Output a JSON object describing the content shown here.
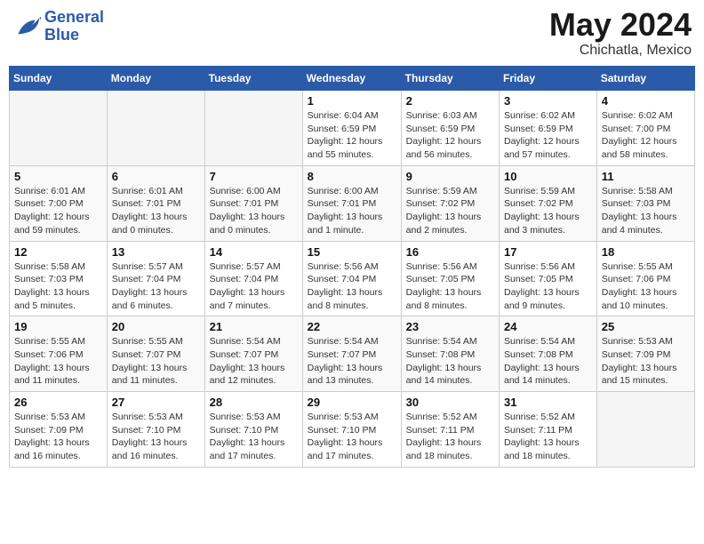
{
  "header": {
    "logo_line1": "General",
    "logo_line2": "Blue",
    "month": "May 2024",
    "location": "Chichatla, Mexico"
  },
  "days_of_week": [
    "Sunday",
    "Monday",
    "Tuesday",
    "Wednesday",
    "Thursday",
    "Friday",
    "Saturday"
  ],
  "weeks": [
    [
      {
        "day": "",
        "info": ""
      },
      {
        "day": "",
        "info": ""
      },
      {
        "day": "",
        "info": ""
      },
      {
        "day": "1",
        "info": "Sunrise: 6:04 AM\nSunset: 6:59 PM\nDaylight: 12 hours\nand 55 minutes."
      },
      {
        "day": "2",
        "info": "Sunrise: 6:03 AM\nSunset: 6:59 PM\nDaylight: 12 hours\nand 56 minutes."
      },
      {
        "day": "3",
        "info": "Sunrise: 6:02 AM\nSunset: 6:59 PM\nDaylight: 12 hours\nand 57 minutes."
      },
      {
        "day": "4",
        "info": "Sunrise: 6:02 AM\nSunset: 7:00 PM\nDaylight: 12 hours\nand 58 minutes."
      }
    ],
    [
      {
        "day": "5",
        "info": "Sunrise: 6:01 AM\nSunset: 7:00 PM\nDaylight: 12 hours\nand 59 minutes."
      },
      {
        "day": "6",
        "info": "Sunrise: 6:01 AM\nSunset: 7:01 PM\nDaylight: 13 hours\nand 0 minutes."
      },
      {
        "day": "7",
        "info": "Sunrise: 6:00 AM\nSunset: 7:01 PM\nDaylight: 13 hours\nand 0 minutes."
      },
      {
        "day": "8",
        "info": "Sunrise: 6:00 AM\nSunset: 7:01 PM\nDaylight: 13 hours\nand 1 minute."
      },
      {
        "day": "9",
        "info": "Sunrise: 5:59 AM\nSunset: 7:02 PM\nDaylight: 13 hours\nand 2 minutes."
      },
      {
        "day": "10",
        "info": "Sunrise: 5:59 AM\nSunset: 7:02 PM\nDaylight: 13 hours\nand 3 minutes."
      },
      {
        "day": "11",
        "info": "Sunrise: 5:58 AM\nSunset: 7:03 PM\nDaylight: 13 hours\nand 4 minutes."
      }
    ],
    [
      {
        "day": "12",
        "info": "Sunrise: 5:58 AM\nSunset: 7:03 PM\nDaylight: 13 hours\nand 5 minutes."
      },
      {
        "day": "13",
        "info": "Sunrise: 5:57 AM\nSunset: 7:04 PM\nDaylight: 13 hours\nand 6 minutes."
      },
      {
        "day": "14",
        "info": "Sunrise: 5:57 AM\nSunset: 7:04 PM\nDaylight: 13 hours\nand 7 minutes."
      },
      {
        "day": "15",
        "info": "Sunrise: 5:56 AM\nSunset: 7:04 PM\nDaylight: 13 hours\nand 8 minutes."
      },
      {
        "day": "16",
        "info": "Sunrise: 5:56 AM\nSunset: 7:05 PM\nDaylight: 13 hours\nand 8 minutes."
      },
      {
        "day": "17",
        "info": "Sunrise: 5:56 AM\nSunset: 7:05 PM\nDaylight: 13 hours\nand 9 minutes."
      },
      {
        "day": "18",
        "info": "Sunrise: 5:55 AM\nSunset: 7:06 PM\nDaylight: 13 hours\nand 10 minutes."
      }
    ],
    [
      {
        "day": "19",
        "info": "Sunrise: 5:55 AM\nSunset: 7:06 PM\nDaylight: 13 hours\nand 11 minutes."
      },
      {
        "day": "20",
        "info": "Sunrise: 5:55 AM\nSunset: 7:07 PM\nDaylight: 13 hours\nand 11 minutes."
      },
      {
        "day": "21",
        "info": "Sunrise: 5:54 AM\nSunset: 7:07 PM\nDaylight: 13 hours\nand 12 minutes."
      },
      {
        "day": "22",
        "info": "Sunrise: 5:54 AM\nSunset: 7:07 PM\nDaylight: 13 hours\nand 13 minutes."
      },
      {
        "day": "23",
        "info": "Sunrise: 5:54 AM\nSunset: 7:08 PM\nDaylight: 13 hours\nand 14 minutes."
      },
      {
        "day": "24",
        "info": "Sunrise: 5:54 AM\nSunset: 7:08 PM\nDaylight: 13 hours\nand 14 minutes."
      },
      {
        "day": "25",
        "info": "Sunrise: 5:53 AM\nSunset: 7:09 PM\nDaylight: 13 hours\nand 15 minutes."
      }
    ],
    [
      {
        "day": "26",
        "info": "Sunrise: 5:53 AM\nSunset: 7:09 PM\nDaylight: 13 hours\nand 16 minutes."
      },
      {
        "day": "27",
        "info": "Sunrise: 5:53 AM\nSunset: 7:10 PM\nDaylight: 13 hours\nand 16 minutes."
      },
      {
        "day": "28",
        "info": "Sunrise: 5:53 AM\nSunset: 7:10 PM\nDaylight: 13 hours\nand 17 minutes."
      },
      {
        "day": "29",
        "info": "Sunrise: 5:53 AM\nSunset: 7:10 PM\nDaylight: 13 hours\nand 17 minutes."
      },
      {
        "day": "30",
        "info": "Sunrise: 5:52 AM\nSunset: 7:11 PM\nDaylight: 13 hours\nand 18 minutes."
      },
      {
        "day": "31",
        "info": "Sunrise: 5:52 AM\nSunset: 7:11 PM\nDaylight: 13 hours\nand 18 minutes."
      },
      {
        "day": "",
        "info": ""
      }
    ]
  ]
}
